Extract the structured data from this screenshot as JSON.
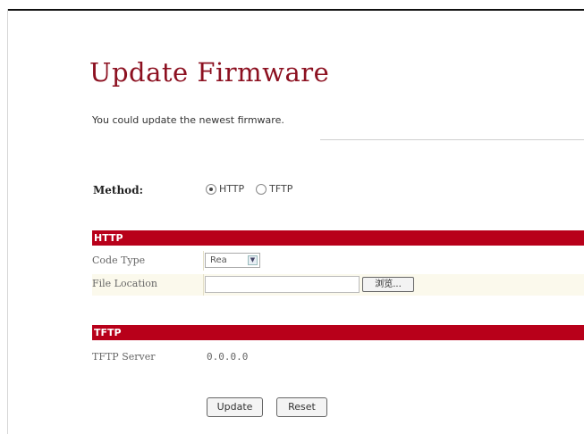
{
  "page": {
    "title": "Update Firmware",
    "description": "You could update the newest firmware."
  },
  "method": {
    "label": "Method:",
    "options": [
      {
        "label": "HTTP",
        "selected": true
      },
      {
        "label": "TFTP",
        "selected": false
      }
    ]
  },
  "http": {
    "header": "HTTP",
    "code_type_label": "Code Type",
    "code_type_value": "Rea",
    "file_location_label": "File Location",
    "file_location_value": "",
    "browse_label": "浏览..."
  },
  "tftp": {
    "header": "TFTP",
    "server_label": "TFTP Server",
    "server_value": "0.0.0.0"
  },
  "buttons": {
    "update": "Update",
    "reset": "Reset"
  },
  "colors": {
    "title": "#8c1020",
    "section_bar": "#b8001a",
    "row_highlight": "#fbf9ec"
  }
}
